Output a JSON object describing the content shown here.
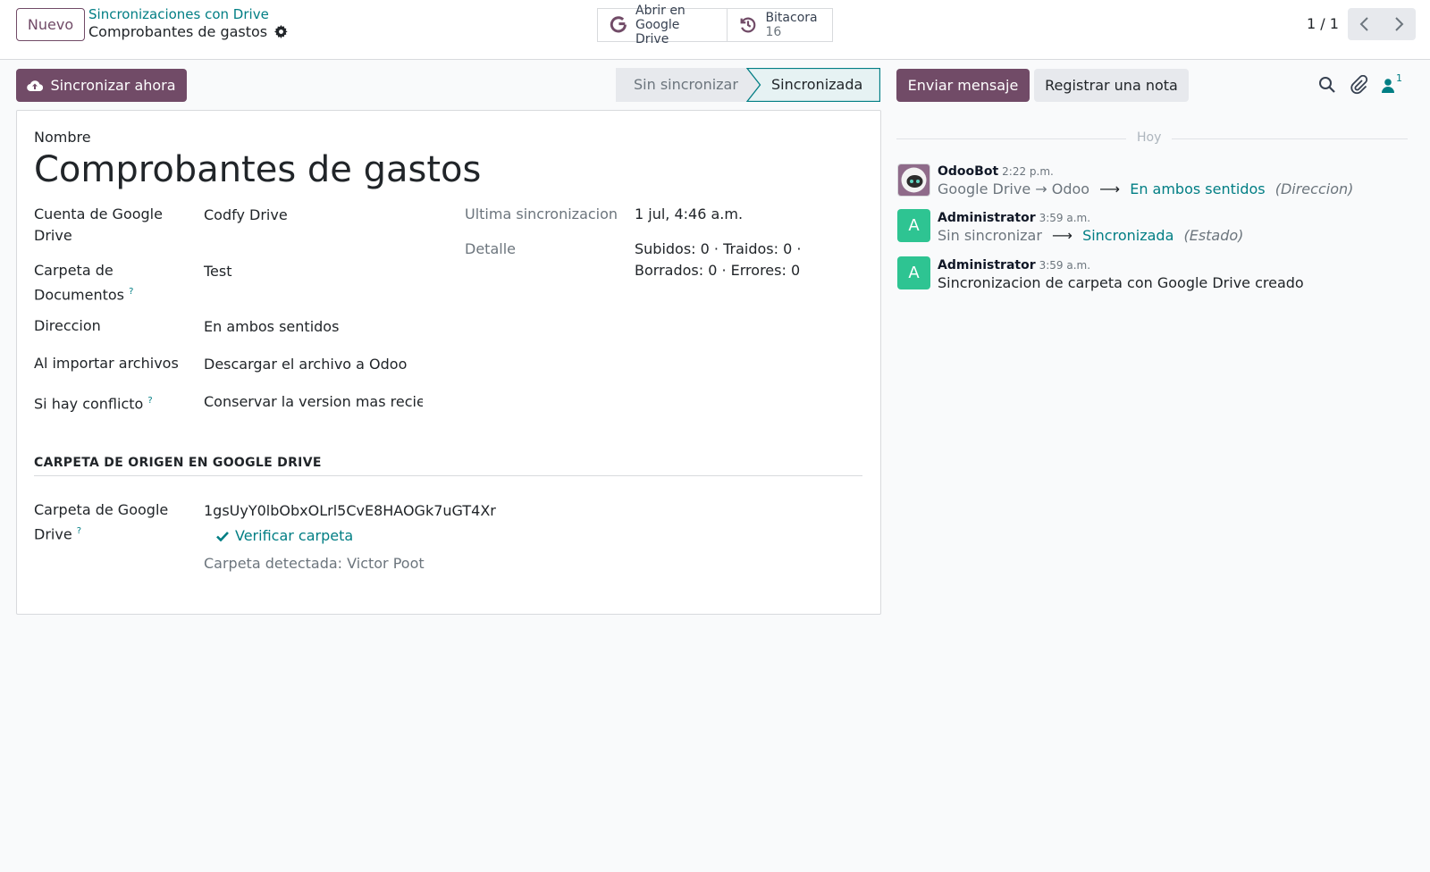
{
  "header": {
    "new_button": "Nuevo",
    "breadcrumb_parent": "Sincronizaciones con Drive",
    "breadcrumb_current": "Comprobantes de gastos",
    "smart_buttons": {
      "drive": {
        "line1": "Abrir en",
        "line2": "Google Drive"
      },
      "log": {
        "line1": "Bitacora",
        "count": "16"
      }
    },
    "pager": "1 / 1"
  },
  "actions": {
    "sync_now": "Sincronizar ahora",
    "status_steps": [
      "Sin sincronizar",
      "Sincronizada"
    ],
    "status_active": "Sincronizada"
  },
  "form": {
    "name_label": "Nombre",
    "name_value": "Comprobantes de gastos",
    "account": {
      "label_line1": "Cuenta de Google",
      "label_line2": "Drive",
      "value": "Codfy Drive"
    },
    "folder": {
      "label_line1": "Carpeta de",
      "label_line2": "Documentos",
      "tooltip": "?",
      "value": "Test"
    },
    "direction": {
      "label": "Direccion",
      "value": "En ambos sentidos"
    },
    "on_import": {
      "label": "Al importar archivos",
      "value": "Descargar el archivo a Odoo"
    },
    "conflict": {
      "label": "Si hay conflicto",
      "tooltip": "?",
      "value": "Conservar la version mas recie"
    },
    "last_sync": {
      "label": "Ultima sincronizacion",
      "value": "1 jul, 4:46 a.m."
    },
    "detail": {
      "label": "Detalle",
      "value_line1": "Subidos: 0 · Traidos: 0 ·",
      "value_line2": "Borrados: 0 · Errores: 0"
    },
    "section_title": "CARPETA DE ORIGEN EN GOOGLE DRIVE",
    "drive_folder": {
      "label_line1": "Carpeta de Google",
      "label_line2": "Drive",
      "tooltip": "?",
      "value": "1gsUyY0lbObxOLrl5CvE8HAOGk7uGT4Xr"
    },
    "verify_button": "Verificar carpeta",
    "detected_folder": "Carpeta detectada: Victor Poot"
  },
  "chatter": {
    "send_message": "Enviar mensaje",
    "log_note": "Registrar una nota",
    "followers_count": "1",
    "date_separator": "Hoy",
    "messages": [
      {
        "author": "OdooBot",
        "time": "2:22 p.m.",
        "old": "Google Drive → Odoo",
        "arrow": "⟶",
        "new": "En ambos sentidos",
        "field": "(Direccion)"
      },
      {
        "author": "Administrator",
        "initial": "A",
        "time": "3:59 a.m.",
        "old": "Sin sincronizar",
        "arrow": "⟶",
        "new": "Sincronizada",
        "field": "(Estado)"
      },
      {
        "author": "Administrator",
        "initial": "A",
        "time": "3:59 a.m.",
        "body": "Sincronizacion de carpeta con Google Drive creado"
      }
    ]
  },
  "colors": {
    "primary": "#714b67",
    "teal": "#017e84",
    "avatar_green": "#2ec492"
  }
}
